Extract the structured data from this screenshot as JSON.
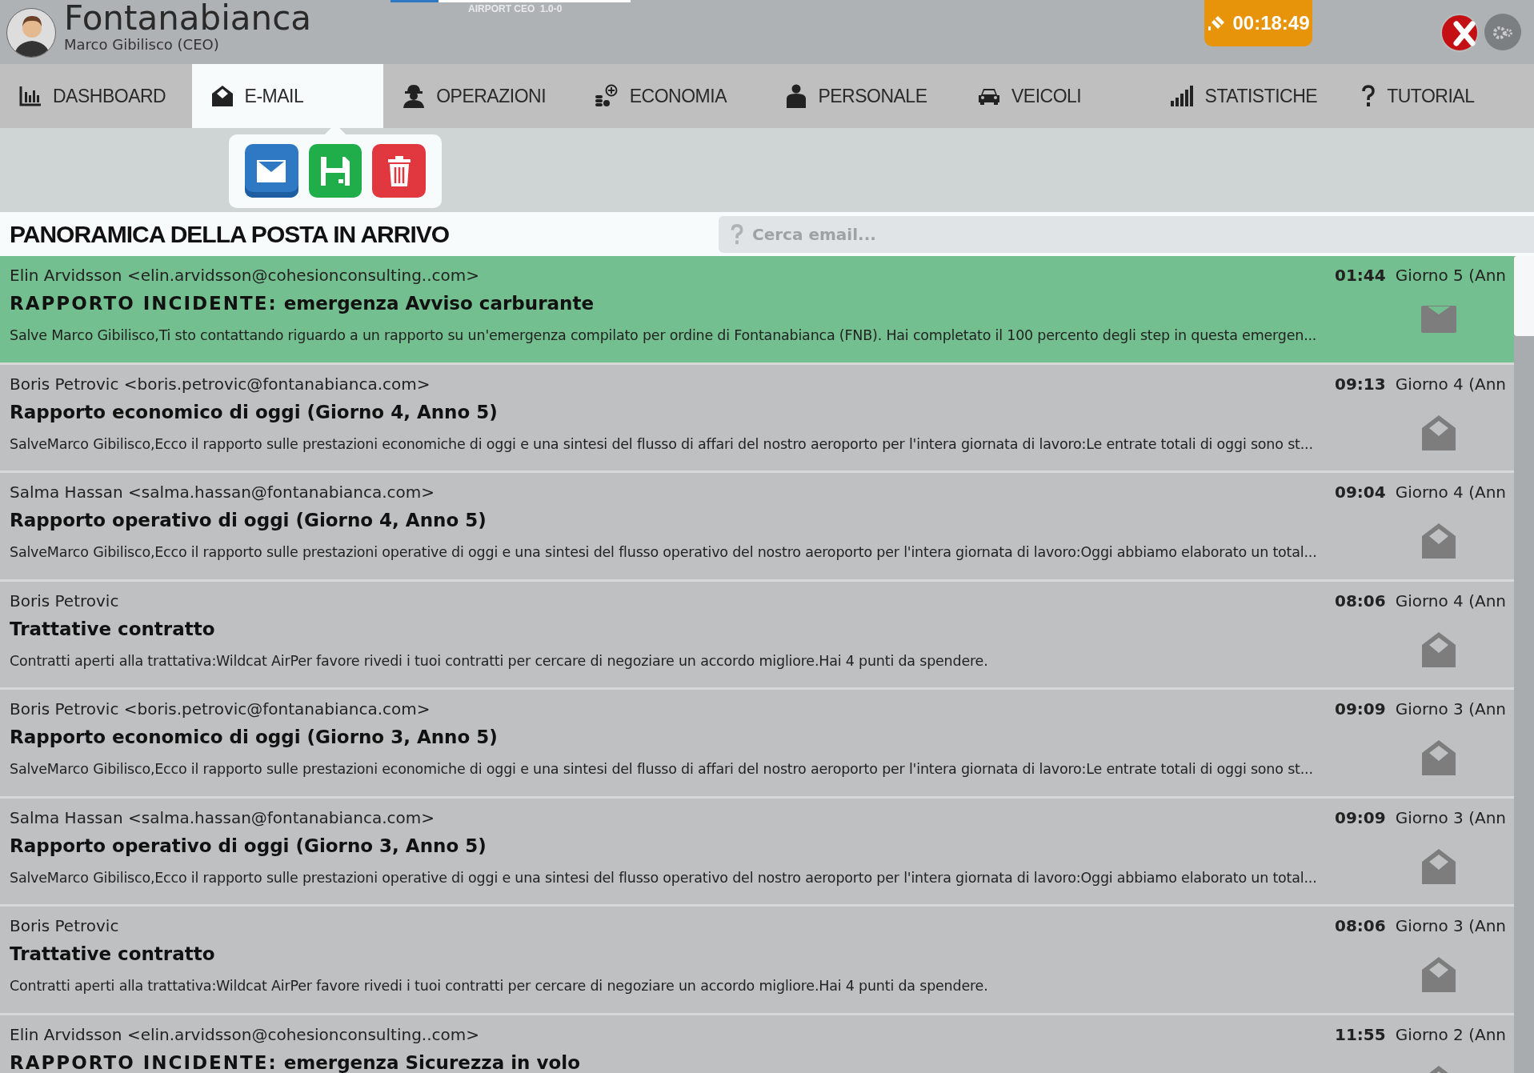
{
  "header": {
    "airport_name": "Fontanabianca",
    "player": "Marco Gibilisco (CEO)",
    "version": "AIRPORT CEO  1.0-0",
    "timer": "00:18:49",
    "loading": {
      "level": 0.2
    }
  },
  "nav_tabs": [
    {
      "label": "DASHBOARD",
      "selected": false
    },
    {
      "label": "E-MAIL",
      "selected": true
    },
    {
      "label": "OPERAZIONI",
      "selected": false
    },
    {
      "label": "ECONOMIA",
      "selected": false
    },
    {
      "label": "PERSONALE",
      "selected": false
    },
    {
      "label": "VEICOLI",
      "selected": false
    },
    {
      "label": "STATISTICHE",
      "selected": false
    },
    {
      "label": "TUTORIAL",
      "selected": false
    }
  ],
  "toolbar": [
    {
      "kind": "mail",
      "selected": true
    },
    {
      "kind": "save",
      "selected": false
    },
    {
      "kind": "delete",
      "selected": false
    }
  ],
  "inbox": {
    "title": "PANORAMICA DELLA POSTA IN ARRIVO",
    "search": {
      "placeholder": "Cerca email..."
    },
    "emails": [
      {
        "sender": "Elin Arvidsson <elin.arvidsson@cohesionconsulting..com>",
        "tag": "RAPPORTO INCIDENTE:",
        "subject": "emergenza Avviso carburante",
        "time": "01:44",
        "date": "Giorno 5 (Ann",
        "preview": "Salve Marco Gibilisco,Ti sto contattando riguardo a un rapporto su un'emergenza compilato per ordine di Fontanabianca (FNB). Hai completato il 100 percento degli step in questa emergen...",
        "read": false,
        "selected": true
      },
      {
        "sender": "Boris Petrovic <boris.petrovic@fontanabianca.com>",
        "subject": "Rapporto economico di oggi (Giorno 4, Anno 5)",
        "time": "09:13",
        "date": "Giorno 4 (Ann",
        "preview": "SalveMarco Gibilisco,Ecco il rapporto sulle prestazioni economiche di oggi e una sintesi del flusso di affari del nostro aeroporto per l'intera giornata di lavoro:Le entrate totali di oggi sono st...",
        "read": true,
        "selected": false
      },
      {
        "sender": "Salma Hassan <salma.hassan@fontanabianca.com>",
        "subject": "Rapporto operativo di oggi (Giorno 4, Anno 5)",
        "time": "09:04",
        "date": "Giorno 4 (Ann",
        "preview": "SalveMarco Gibilisco,Ecco il rapporto sulle prestazioni operative di oggi e una sintesi del flusso operativo del nostro aeroporto per l'intera giornata di lavoro:Oggi abbiamo elaborato un total...",
        "read": true,
        "selected": false
      },
      {
        "sender": "Boris Petrovic",
        "subject": "Trattative contratto",
        "time": "08:06",
        "date": "Giorno 4 (Ann",
        "preview": "Contratti aperti alla trattativa:Wildcat AirPer favore rivedi i tuoi contratti per cercare di negoziare un accordo migliore.Hai 4 punti da spendere.",
        "read": true,
        "selected": false
      },
      {
        "sender": "Boris Petrovic <boris.petrovic@fontanabianca.com>",
        "subject": "Rapporto economico di oggi (Giorno 3, Anno 5)",
        "time": "09:09",
        "date": "Giorno 3 (Ann",
        "preview": "SalveMarco Gibilisco,Ecco il rapporto sulle prestazioni economiche di oggi e una sintesi del flusso di affari del nostro aeroporto per l'intera giornata di lavoro:Le entrate totali di oggi sono st...",
        "read": true,
        "selected": false
      },
      {
        "sender": "Salma Hassan <salma.hassan@fontanabianca.com>",
        "subject": "Rapporto operativo di oggi (Giorno 3, Anno 5)",
        "time": "09:09",
        "date": "Giorno 3 (Ann",
        "preview": "SalveMarco Gibilisco,Ecco il rapporto sulle prestazioni operative di oggi e una sintesi del flusso operativo del nostro aeroporto per l'intera giornata di lavoro:Oggi abbiamo elaborato un total...",
        "read": true,
        "selected": false
      },
      {
        "sender": "Boris Petrovic",
        "subject": "Trattative contratto",
        "time": "08:06",
        "date": "Giorno 3 (Ann",
        "preview": "Contratti aperti alla trattativa:Wildcat AirPer favore rivedi i tuoi contratti per cercare di negoziare un accordo migliore.Hai 4 punti da spendere.",
        "read": true,
        "selected": false
      },
      {
        "sender": "Elin Arvidsson <elin.arvidsson@cohesionconsulting..com>",
        "tag": "RAPPORTO INCIDENTE:",
        "subject": "emergenza Sicurezza in volo",
        "time": "11:55",
        "date": "Giorno 2 (Ann",
        "read": true,
        "selected": false
      }
    ]
  }
}
